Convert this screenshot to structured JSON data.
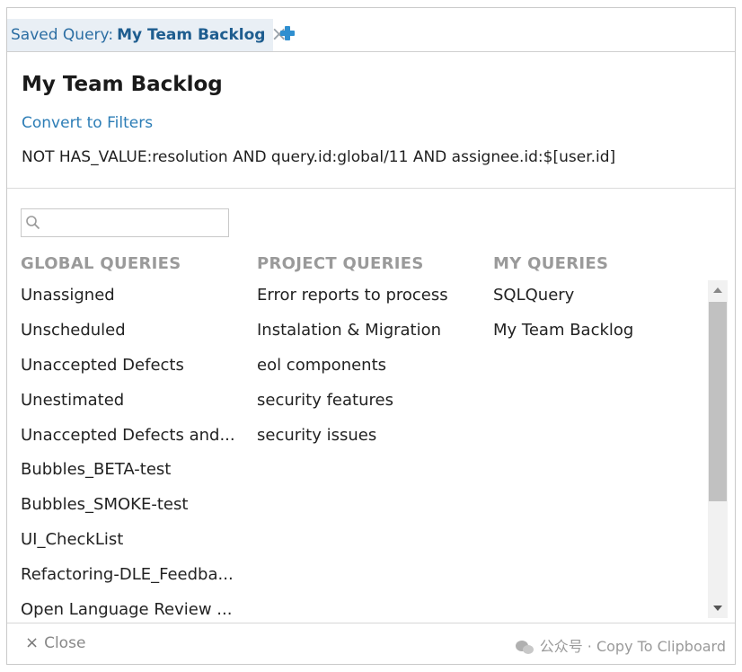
{
  "tab": {
    "prefix": "Saved Query:",
    "name": "My Team Backlog",
    "close_glyph": "×",
    "add_icon": "plus-icon"
  },
  "header": {
    "title": "My Team Backlog",
    "convert_link": "Convert to Filters",
    "query_text": "NOT HAS_VALUE:resolution AND query.id:global/11 AND assignee.id:$[user.id]"
  },
  "search": {
    "placeholder": "",
    "value": "",
    "icon": "search-icon"
  },
  "columns": {
    "global": {
      "header": "GLOBAL QUERIES",
      "items": [
        "Unassigned",
        "Unscheduled",
        "Unaccepted Defects",
        "Unestimated",
        "Unaccepted Defects and...",
        "Bubbles_BETA-test",
        "Bubbles_SMOKE-test",
        "UI_CheckList",
        "Refactoring-DLE_Feedba...",
        "Open Language Review ..."
      ]
    },
    "project": {
      "header": "PROJECT QUERIES",
      "items": [
        "Error reports to process",
        "Instalation & Migration",
        "eol components",
        "security features",
        "security issues"
      ]
    },
    "mine": {
      "header": "MY QUERIES",
      "items": [
        "SQLQuery",
        "My Team Backlog"
      ]
    }
  },
  "footer": {
    "close_glyph": "×",
    "close_label": "Close",
    "watermark": "公众号 · Copy To Clipboard"
  },
  "colors": {
    "tab_bg": "#e9eff5",
    "link": "#2c7db6",
    "header_gray": "#9a9a9a",
    "add_icon": "#2f8fd0"
  }
}
